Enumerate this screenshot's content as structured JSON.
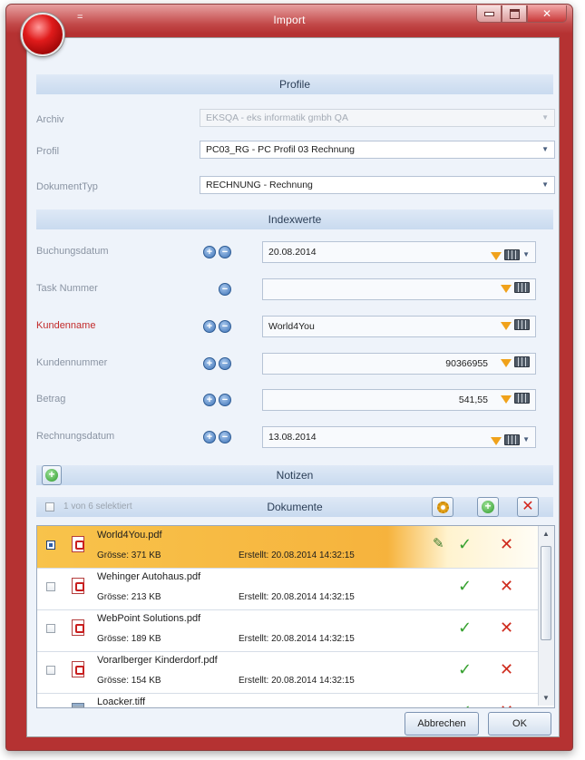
{
  "window": {
    "title": "Import",
    "qat_symbol": "="
  },
  "profile": {
    "header": "Profile",
    "rows": [
      {
        "label": "Archiv",
        "value": "EKSQA - eks informatik gmbh QA",
        "disabled": true
      },
      {
        "label": "Profil",
        "value": "PC03_RG - PC Profil 03 Rechnung",
        "disabled": false
      },
      {
        "label": "DokumentTyp",
        "value": "RECHNUNG - Rechnung",
        "disabled": false
      }
    ]
  },
  "index": {
    "header": "Indexwerte",
    "rows": [
      {
        "label": "Buchungsdatum",
        "value": "20.08.2014",
        "align": "left",
        "required": false
      },
      {
        "label": "Task Nummer",
        "value": "",
        "align": "left",
        "required": false
      },
      {
        "label": "Kundenname",
        "value": "World4You",
        "align": "left",
        "required": true
      },
      {
        "label": "Kundennummer",
        "value": "90366955",
        "align": "right",
        "required": false
      },
      {
        "label": "Betrag",
        "value": "541,55",
        "align": "right",
        "required": false
      },
      {
        "label": "Rechnungsdatum",
        "value": "13.08.2014",
        "align": "left",
        "required": false
      }
    ]
  },
  "notes": {
    "header": "Notizen"
  },
  "documents": {
    "header": "Dokumente",
    "selection_text": "1 von 6 selektiert",
    "items": [
      {
        "name": "World4You.pdf",
        "size": "Grösse: 371 KB",
        "created": "Erstellt: 20.08.2014 14:32:15",
        "selected": true,
        "type": "pdf"
      },
      {
        "name": "Wehinger Autohaus.pdf",
        "size": "Grösse: 213 KB",
        "created": "Erstellt: 20.08.2014 14:32:15",
        "selected": false,
        "type": "pdf"
      },
      {
        "name": "WebPoint Solutions.pdf",
        "size": "Grösse: 189 KB",
        "created": "Erstellt: 20.08.2014 14:32:15",
        "selected": false,
        "type": "pdf"
      },
      {
        "name": "Vorarlberger Kinderdorf.pdf",
        "size": "Grösse: 154 KB",
        "created": "Erstellt: 20.08.2014 14:32:15",
        "selected": false,
        "type": "pdf"
      },
      {
        "name": "Loacker.tiff",
        "size": "",
        "created": "",
        "selected": false,
        "type": "tiff"
      }
    ]
  },
  "buttons": {
    "cancel": "Abbrechen",
    "ok": "OK"
  },
  "colors": {
    "frame": "#b53232",
    "client_bg": "#eef3fa",
    "section_header": "#c9daef",
    "selected_row": "#f6b33d",
    "required_label": "#c22a2a"
  }
}
